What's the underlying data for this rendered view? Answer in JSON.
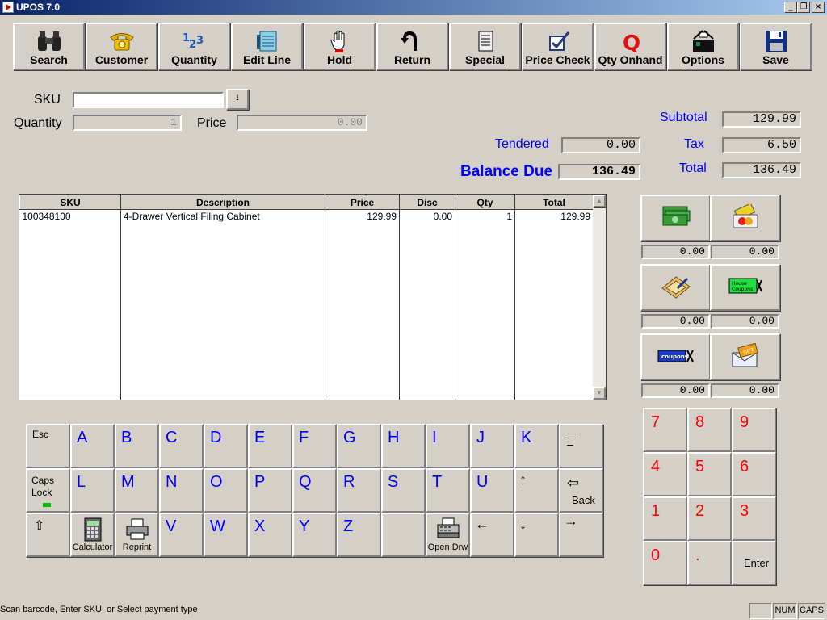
{
  "window": {
    "title": "UPOS 7.0"
  },
  "toolbar": [
    {
      "label": "Search",
      "icon": "binoculars-icon"
    },
    {
      "label": "Customer",
      "icon": "telephone-icon"
    },
    {
      "label": "Quantity",
      "icon": "numbers-icon"
    },
    {
      "label": "Edit Line",
      "icon": "notepad-icon"
    },
    {
      "label": "Hold",
      "icon": "hand-icon"
    },
    {
      "label": "Return",
      "icon": "return-arrow-icon"
    },
    {
      "label": "Special",
      "icon": "document-icon"
    },
    {
      "label": "Price Check",
      "icon": "checkmark-icon"
    },
    {
      "label": "Qty Onhand",
      "icon": "q-icon"
    },
    {
      "label": "Options",
      "icon": "options-icon"
    },
    {
      "label": "Save",
      "icon": "floppy-disk-icon"
    }
  ],
  "entry": {
    "sku_label": "SKU",
    "sku_value": "",
    "quantity_label": "Quantity",
    "quantity_value": "1",
    "price_label": "Price",
    "price_value": "0.00"
  },
  "totals": {
    "tendered_label": "Tendered",
    "tendered_value": "0.00",
    "balance_label": "Balance Due",
    "balance_value": "136.49",
    "subtotal_label": "Subtotal",
    "subtotal_value": "129.99",
    "tax_label": "Tax",
    "tax_value": "6.50",
    "total_label": "Total",
    "total_value": "136.49"
  },
  "grid": {
    "columns": [
      "SKU",
      "Description",
      "Price",
      "Disc",
      "Qty",
      "Total"
    ],
    "rows": [
      {
        "sku": "100348100",
        "description": "4-Drawer Vertical Filing Cabinet",
        "price": "129.99",
        "disc": "0.00",
        "qty": "1",
        "total": "129.99"
      }
    ]
  },
  "payments": [
    {
      "icon": "cash-icon",
      "amount": "0.00"
    },
    {
      "icon": "credit-card-icon",
      "amount": "0.00"
    },
    {
      "icon": "check-icon",
      "amount": "0.00"
    },
    {
      "icon": "house-coupons-icon",
      "label": "House Coupons",
      "amount": "0.00"
    },
    {
      "icon": "coupons-icon",
      "label": "coupons",
      "amount": "0.00"
    },
    {
      "icon": "gift-certificate-icon",
      "label": "GIFT",
      "amount": "0.00"
    }
  ],
  "keyboard": {
    "esc": "Esc",
    "caps_line1": "Caps",
    "caps_line2": "Lock",
    "back": "Back",
    "calculator": "Calculator",
    "reprint": "Reprint",
    "open_drawer": "Open Drw",
    "row1": [
      "A",
      "B",
      "C",
      "D",
      "E",
      "F",
      "G",
      "H",
      "I",
      "J",
      "K"
    ],
    "row2": [
      "L",
      "M",
      "N",
      "O",
      "P",
      "Q",
      "R",
      "S",
      "T",
      "U"
    ],
    "row3": [
      "V",
      "W",
      "X",
      "Y",
      "Z"
    ]
  },
  "numpad": {
    "keys": [
      "7",
      "8",
      "9",
      "4",
      "5",
      "6",
      "1",
      "2",
      "3",
      "0",
      "."
    ],
    "enter": "Enter"
  },
  "status": {
    "message": "Scan barcode, Enter SKU, or Select payment type",
    "num": "NUM",
    "caps": "CAPS"
  },
  "colors": {
    "accent_blue": "#0000ff",
    "numpad_red": "#ff0000",
    "caps_indicator": "#00c000"
  }
}
